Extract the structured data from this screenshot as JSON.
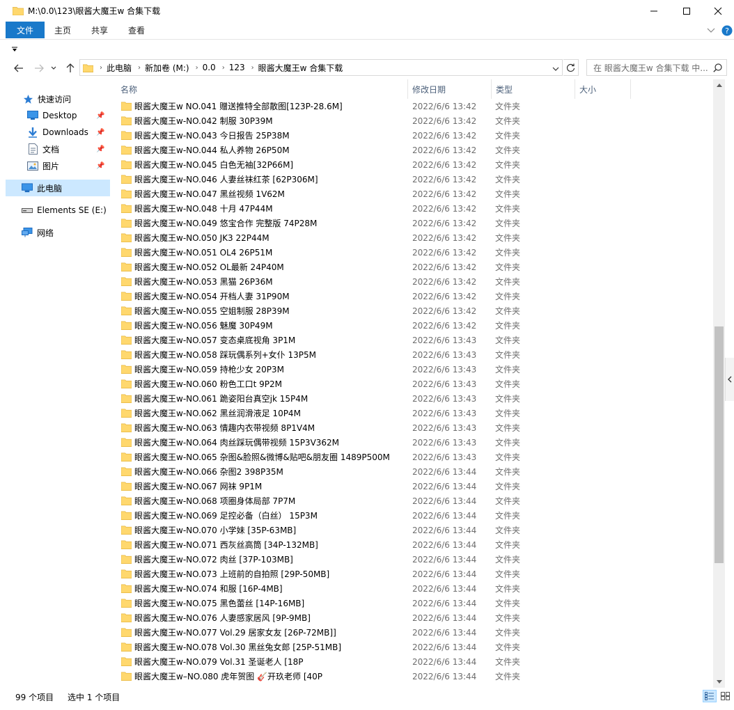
{
  "window": {
    "title": "M:\\0.0\\123\\眼酱大魔王w 合集下载",
    "minimize_icon": "minimize-icon",
    "maximize_icon": "maximize-icon",
    "close_icon": "close-icon"
  },
  "ribbon": {
    "tabs": [
      {
        "label": "文件",
        "active": true
      },
      {
        "label": "主页",
        "active": false
      },
      {
        "label": "共享",
        "active": false
      },
      {
        "label": "查看",
        "active": false
      }
    ],
    "accent": "#1979ca"
  },
  "address": {
    "crumbs": [
      "此电脑",
      "新加卷 (M:)",
      "0.0",
      "123",
      "眼酱大魔王w 合集下载"
    ],
    "search_placeholder": "在 眼酱大魔王w 合集下载 中..."
  },
  "nav": {
    "quick_access": "快速访问",
    "items": [
      {
        "label": "Desktop",
        "icon": "desktop-icon",
        "pinned": true
      },
      {
        "label": "Downloads",
        "icon": "download-arrow-icon",
        "pinned": true
      },
      {
        "label": "文档",
        "icon": "document-icon",
        "pinned": true
      },
      {
        "label": "图片",
        "icon": "picture-icon",
        "pinned": true
      }
    ],
    "this_pc": "此电脑",
    "drive": "Elements SE (E:)",
    "network": "网络"
  },
  "columns": {
    "name": "名称",
    "date": "修改日期",
    "type": "类型",
    "size": "大小"
  },
  "files": [
    {
      "name": "眼酱大魔王w NO.041 赠送推特全部散图[123P-28.6M]",
      "date": "2022/6/6 13:42",
      "type": "文件夹"
    },
    {
      "name": "眼酱大魔王w-NO.042 制服 30P39M",
      "date": "2022/6/6 13:42",
      "type": "文件夹"
    },
    {
      "name": "眼酱大魔王w-NO.043 今日报告 25P38M",
      "date": "2022/6/6 13:42",
      "type": "文件夹"
    },
    {
      "name": "眼酱大魔王w-NO.044 私人养物 26P50M",
      "date": "2022/6/6 13:42",
      "type": "文件夹"
    },
    {
      "name": "眼酱大魔王w-NO.045 白色无袖[32P66M]",
      "date": "2022/6/6 13:42",
      "type": "文件夹"
    },
    {
      "name": "眼酱大魔王w-NO.046 人妻丝袜红茶 [62P306M]",
      "date": "2022/6/6 13:42",
      "type": "文件夹"
    },
    {
      "name": "眼酱大魔王w-NO.047 黑丝视频 1V62M",
      "date": "2022/6/6 13:42",
      "type": "文件夹"
    },
    {
      "name": "眼酱大魔王w-NO.048 十月 47P44M",
      "date": "2022/6/6 13:42",
      "type": "文件夹"
    },
    {
      "name": "眼酱大魔王w-NO.049 悠宝合作 完整版 74P28M",
      "date": "2022/6/6 13:42",
      "type": "文件夹"
    },
    {
      "name": "眼酱大魔王w-NO.050 JK3 22P44M",
      "date": "2022/6/6 13:42",
      "type": "文件夹"
    },
    {
      "name": "眼酱大魔王w-NO.051 OL4 26P51M",
      "date": "2022/6/6 13:42",
      "type": "文件夹"
    },
    {
      "name": "眼酱大魔王w-NO.052 OL最新 24P40M",
      "date": "2022/6/6 13:42",
      "type": "文件夹"
    },
    {
      "name": "眼酱大魔王w-NO.053 黑猫 26P36M",
      "date": "2022/6/6 13:42",
      "type": "文件夹"
    },
    {
      "name": "眼酱大魔王w-NO.054 开档人妻 31P90M",
      "date": "2022/6/6 13:42",
      "type": "文件夹"
    },
    {
      "name": "眼酱大魔王w-NO.055 空姐制服 28P39M",
      "date": "2022/6/6 13:42",
      "type": "文件夹"
    },
    {
      "name": "眼酱大魔王w-NO.056 魅魔 30P49M",
      "date": "2022/6/6 13:42",
      "type": "文件夹"
    },
    {
      "name": "眼酱大魔王w-NO.057 变态桌底视角 3P1M",
      "date": "2022/6/6 13:43",
      "type": "文件夹"
    },
    {
      "name": "眼酱大魔王w-NO.058 踩玩偶系列+女仆 13P5M",
      "date": "2022/6/6 13:43",
      "type": "文件夹"
    },
    {
      "name": "眼酱大魔王w-NO.059 持枪少女 20P3M",
      "date": "2022/6/6 13:43",
      "type": "文件夹"
    },
    {
      "name": "眼酱大魔王w-NO.060 粉色工口t 9P2M",
      "date": "2022/6/6 13:43",
      "type": "文件夹"
    },
    {
      "name": "眼酱大魔王w-NO.061 跪姿阳台真空jk 15P4M",
      "date": "2022/6/6 13:43",
      "type": "文件夹"
    },
    {
      "name": "眼酱大魔王w-NO.062 黑丝润滑液足 10P4M",
      "date": "2022/6/6 13:43",
      "type": "文件夹"
    },
    {
      "name": "眼酱大魔王w-NO.063 情趣内衣带视频 8P1V4M",
      "date": "2022/6/6 13:43",
      "type": "文件夹"
    },
    {
      "name": "眼酱大魔王w-NO.064 肉丝踩玩偶带视频 15P3V362M",
      "date": "2022/6/6 13:43",
      "type": "文件夹"
    },
    {
      "name": "眼酱大魔王w-NO.065 杂图&脸照&微博&贴吧&朋友圈 1489P500M",
      "date": "2022/6/6 13:43",
      "type": "文件夹"
    },
    {
      "name": "眼酱大魔王w-NO.066 杂图2 398P35M",
      "date": "2022/6/6 13:44",
      "type": "文件夹"
    },
    {
      "name": "眼酱大魔王w-NO.067 网袜 9P1M",
      "date": "2022/6/6 13:44",
      "type": "文件夹"
    },
    {
      "name": "眼酱大魔王w-NO.068 项圈身体局部 7P7M",
      "date": "2022/6/6 13:44",
      "type": "文件夹"
    },
    {
      "name": "眼酱大魔王w-NO.069 足控必备（白丝） 15P3M",
      "date": "2022/6/6 13:44",
      "type": "文件夹"
    },
    {
      "name": "眼酱大魔王w-NO.070 小学妹 [35P-63MB]",
      "date": "2022/6/6 13:44",
      "type": "文件夹"
    },
    {
      "name": "眼酱大魔王w-NO.071 西灰丝高筒 [34P-132MB]",
      "date": "2022/6/6 13:44",
      "type": "文件夹"
    },
    {
      "name": "眼酱大魔王w-NO.072 肉丝 [37P-103MB]",
      "date": "2022/6/6 13:44",
      "type": "文件夹"
    },
    {
      "name": "眼酱大魔王w-NO.073 上班前的自拍照 [29P-50MB]",
      "date": "2022/6/6 13:44",
      "type": "文件夹"
    },
    {
      "name": "眼酱大魔王w-NO.074 和服 [16P-4MB]",
      "date": "2022/6/6 13:44",
      "type": "文件夹"
    },
    {
      "name": "眼酱大魔王w-NO.075 黑色蕾丝 [14P-16MB]",
      "date": "2022/6/6 13:44",
      "type": "文件夹"
    },
    {
      "name": "眼酱大魔王w-NO.076 人妻感家居风 [9P-9MB]",
      "date": "2022/6/6 13:44",
      "type": "文件夹"
    },
    {
      "name": "眼酱大魔王w-NO.077 Vol.29 居家女友 [26P-72MB]]",
      "date": "2022/6/6 13:44",
      "type": "文件夹"
    },
    {
      "name": "眼酱大魔王w-NO.078 Vol.30 黑丝兔女郎 [25P-51MB]",
      "date": "2022/6/6 13:44",
      "type": "文件夹"
    },
    {
      "name": "眼酱大魔王w-NO.079 Vol.31 圣诞老人 [18P",
      "date": "2022/6/6 13:44",
      "type": "文件夹"
    },
    {
      "name": "眼酱大魔王w–NO.080 虎年贺图 🎸开玖老师 [40P",
      "date": "2022/6/6 13:44",
      "type": "文件夹"
    }
  ],
  "status": {
    "count": "99 个项目",
    "selection": "选中 1 个项目"
  },
  "colors": {
    "folder": "#ffd86e",
    "selection": "#cce8ff",
    "header_text": "#4c607a"
  }
}
